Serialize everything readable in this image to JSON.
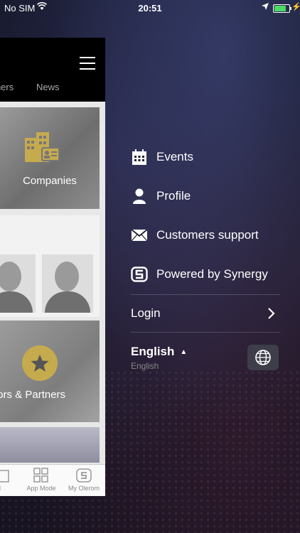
{
  "status_bar": {
    "carrier": "No SIM",
    "time": "20:51",
    "battery_level": 0.9
  },
  "app_preview": {
    "tabs": [
      "rtners",
      "News"
    ],
    "cards": {
      "companies": "Companies",
      "sponsors": "onsors & Partners"
    },
    "bottom_nav": [
      "il",
      "App Mode",
      "My Olerom"
    ]
  },
  "menu": {
    "items": [
      {
        "label": "Events",
        "icon": "calendar-icon"
      },
      {
        "label": "Profile",
        "icon": "person-icon"
      },
      {
        "label": "Customers support",
        "icon": "envelope-icon"
      },
      {
        "label": "Powered by Synergy",
        "icon": "synergy-logo-icon"
      }
    ],
    "login": {
      "label": "Login",
      "icon": "chevron-right-icon"
    },
    "language": {
      "selected": "English",
      "subtitle": "English",
      "icon": "globe-icon"
    }
  },
  "colors": {
    "gold": "#c6aa4e",
    "menu_text": "#ffffff",
    "globe_button": "#3d3e4a"
  }
}
